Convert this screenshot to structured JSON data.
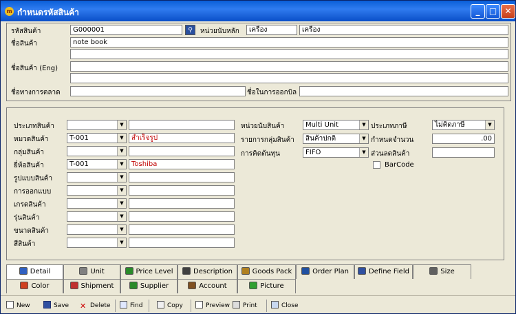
{
  "window": {
    "title": "กำหนดรหัสสินค้า"
  },
  "header": {
    "code_label": "รหัสสินค้า",
    "code_value": "G000001",
    "unit_label": "หน่วยนับหลัก",
    "unit_value1": "เครื่อง",
    "unit_value2": "เครื่อง",
    "name_label": "ชื่อสินค้า",
    "name_value": "note book",
    "name_eng_label": "ชื่อสินค้า (Eng)",
    "market_name_label": "ชื่อทางการตลาด",
    "bill_name_label": "ชื่อในการออกบิล"
  },
  "detail": {
    "left_rows": [
      {
        "label": "ประเภทสินค้า",
        "code": "",
        "desc": ""
      },
      {
        "label": "หมวดสินค้า",
        "code": "T-001",
        "desc": "สำเร็จรูป"
      },
      {
        "label": "กลุ่มสินค้า",
        "code": "",
        "desc": ""
      },
      {
        "label": "ยี่ห้อสินค้า",
        "code": "T-001",
        "desc": "Toshiba"
      },
      {
        "label": "รูปแบบสินค้า",
        "code": "",
        "desc": ""
      },
      {
        "label": "การออกแบบ",
        "code": "",
        "desc": ""
      },
      {
        "label": "เกรดสินค้า",
        "code": "",
        "desc": ""
      },
      {
        "label": "รุ่นสินค้า",
        "code": "",
        "desc": ""
      },
      {
        "label": "ขนาดสินค้า",
        "code": "",
        "desc": ""
      },
      {
        "label": "สีสินค้า",
        "code": "",
        "desc": ""
      }
    ],
    "unit_type_label": "หน่วยนับสินค้า",
    "unit_type_value": "Multi Unit",
    "group_list_label": "รายการกลุ่มสินค้า",
    "group_list_value": "สินค้าปกติ",
    "cost_label": "การคิดต้นทุน",
    "cost_value": "FIFO",
    "tax_type_label": "ประเภทภาษี",
    "tax_type_value": "ไม่คิดภาษี",
    "qty_label": "กำหนดจำนวน",
    "qty_value": ".00",
    "discount_label": "ส่วนลดสินค้า",
    "discount_value": "",
    "barcode_label": "BarCode",
    "barcode_checked": false
  },
  "tabs_row1": [
    {
      "label": "Detail",
      "icon": "detail-icon",
      "color": "#3060c0"
    },
    {
      "label": "Unit",
      "icon": "unit-icon",
      "color": "#808080"
    },
    {
      "label": "Price Level",
      "icon": "price-level-icon",
      "color": "#2a8a2a"
    },
    {
      "label": "Description",
      "icon": "description-icon",
      "color": "#404040"
    },
    {
      "label": "Goods Pack",
      "icon": "goods-pack-icon",
      "color": "#b08020"
    },
    {
      "label": "Order Plan",
      "icon": "order-plan-icon",
      "color": "#2050a0"
    },
    {
      "label": "Define Field",
      "icon": "define-field-icon",
      "color": "#3050a0"
    },
    {
      "label": "Size",
      "icon": "size-icon",
      "color": "#606060"
    }
  ],
  "tabs_row2": [
    {
      "label": "Color",
      "icon": "color-icon",
      "color": "#d04020"
    },
    {
      "label": "Shipment",
      "icon": "shipment-icon",
      "color": "#c03030"
    },
    {
      "label": "Supplier",
      "icon": "supplier-icon",
      "color": "#2a8a2a"
    },
    {
      "label": "Account",
      "icon": "account-icon",
      "color": "#805020"
    },
    {
      "label": "Picture",
      "icon": "picture-icon",
      "color": "#30a030"
    }
  ],
  "toolbar": {
    "new": "New",
    "save": "Save",
    "delete": "Delete",
    "find": "Find",
    "copy": "Copy",
    "preview": "Preview",
    "print": "Print",
    "close": "Close"
  }
}
